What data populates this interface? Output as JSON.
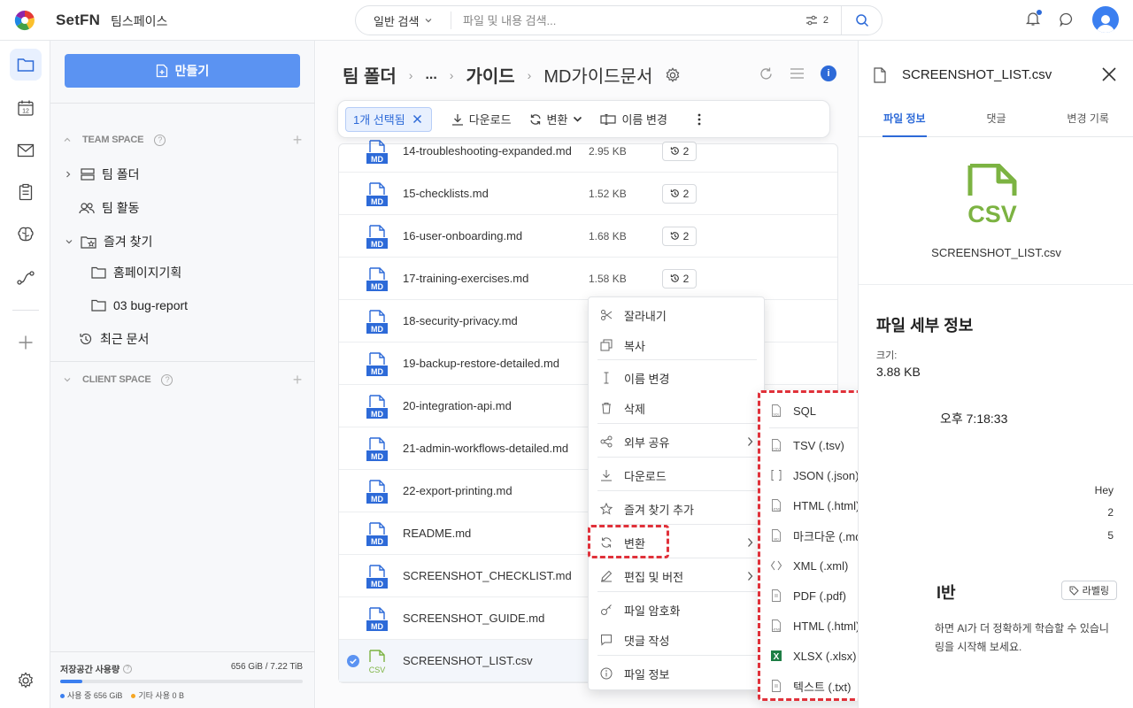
{
  "app": {
    "brand": "SetFN",
    "workspace": "팀스페이스"
  },
  "search": {
    "type_label": "일반 검색",
    "placeholder": "파일 및 내용 검색...",
    "filter_count": "2"
  },
  "sidebar": {
    "create_label": "만들기",
    "team_space_label": "TEAM SPACE",
    "client_space_label": "CLIENT SPACE",
    "items": [
      {
        "label": "팀 폴더"
      },
      {
        "label": "팀 활동"
      },
      {
        "label": "즐겨 찾기"
      },
      {
        "label": "홈페이지기획"
      },
      {
        "label": "03 bug-report"
      },
      {
        "label": "최근 문서"
      }
    ],
    "storage": {
      "title": "저장공간 사용량",
      "size": "656 GiB / 7.22 TiB",
      "used_fraction": 0.09,
      "legend_used": "사용 중 656 GiB",
      "legend_other": "기타 사용 0 B"
    }
  },
  "breadcrumb": {
    "root": "팀 폴더",
    "ellipsis": "...",
    "mid": "가이드",
    "current": "MD가이드문서"
  },
  "toolbar": {
    "selected_label": "1개 선택됨",
    "download_label": "다운로드",
    "convert_label": "변환",
    "rename_label": "이름 변경"
  },
  "files": [
    {
      "name": "14-troubleshooting-expanded.md",
      "size": "2.95 KB",
      "versions": "2",
      "type": "md"
    },
    {
      "name": "15-checklists.md",
      "size": "1.52 KB",
      "versions": "2",
      "type": "md"
    },
    {
      "name": "16-user-onboarding.md",
      "size": "1.68 KB",
      "versions": "2",
      "type": "md"
    },
    {
      "name": "17-training-exercises.md",
      "size": "1.58 KB",
      "versions": "2",
      "type": "md"
    },
    {
      "name": "18-security-privacy.md",
      "size": "",
      "versions": "",
      "type": "md"
    },
    {
      "name": "19-backup-restore-detailed.md",
      "size": "",
      "versions": "",
      "type": "md"
    },
    {
      "name": "20-integration-api.md",
      "size": "",
      "versions": "",
      "type": "md"
    },
    {
      "name": "21-admin-workflows-detailed.md",
      "size": "",
      "versions": "",
      "type": "md"
    },
    {
      "name": "22-export-printing.md",
      "size": "",
      "versions": "",
      "type": "md"
    },
    {
      "name": "README.md",
      "size": "",
      "versions": "",
      "type": "md"
    },
    {
      "name": "SCREENSHOT_CHECKLIST.md",
      "size": "",
      "versions": "",
      "type": "md"
    },
    {
      "name": "SCREENSHOT_GUIDE.md",
      "size": "",
      "versions": "",
      "type": "md"
    },
    {
      "name": "SCREENSHOT_LIST.csv",
      "size": "",
      "versions": "",
      "type": "csv"
    }
  ],
  "context_menu": [
    {
      "label": "잘라내기",
      "icon": "scissors-icon"
    },
    {
      "label": "복사",
      "icon": "copy-icon"
    },
    {
      "label": "이름 변경",
      "icon": "text-cursor-icon"
    },
    {
      "label": "삭제",
      "icon": "trash-icon"
    },
    {
      "label": "외부 공유",
      "icon": "share-icon"
    },
    {
      "label": "다운로드",
      "icon": "download-icon"
    },
    {
      "label": "즐겨 찾기 추가",
      "icon": "star-icon"
    },
    {
      "label": "변환",
      "icon": "convert-icon"
    },
    {
      "label": "편집 및 버전",
      "icon": "pencil-icon"
    },
    {
      "label": "파일 암호화",
      "icon": "key-icon"
    },
    {
      "label": "댓글 작성",
      "icon": "comment-icon"
    },
    {
      "label": "파일 정보",
      "icon": "info-icon"
    }
  ],
  "convert_submenu": [
    {
      "label": "SQL",
      "icon_text": "SQL"
    },
    {
      "label": "TSV (.tsv)",
      "icon_text": "CSV"
    },
    {
      "label": "JSON (.json)",
      "icon_text": "[ ]"
    },
    {
      "label": "HTML (.html)",
      "icon_text": "HTML"
    },
    {
      "label": "마크다운 (.md)",
      "icon_text": "MD"
    },
    {
      "label": "XML (.xml)",
      "icon_text": "< >"
    },
    {
      "label": "PDF (.pdf)",
      "icon_text": ""
    },
    {
      "label": "HTML (.html)",
      "icon_text": "HTML"
    },
    {
      "label": "XLSX (.xlsx)",
      "icon_text": "X"
    },
    {
      "label": "텍스트 (.txt)",
      "icon_text": ""
    }
  ],
  "right_panel": {
    "title": "SCREENSHOT_LIST.csv",
    "tabs": [
      "파일 정보",
      "댓글",
      "변경 기록"
    ],
    "file_name": "SCREENSHOT_LIST.csv",
    "icon_text": "CSV",
    "details_heading": "파일 세부 정보",
    "size_label": "크기:",
    "size_value": "3.88 KB",
    "time_partial": "오후 7:18:33",
    "heading_partial": "ᅡ",
    "row_hey": "Hey",
    "row_2": "2",
    "row_5": "5",
    "ai_heading_partial": "l반",
    "label_button": "라벨링",
    "ai_text_1": "하면 AI가 더 정확하게 학습할 수 있습니",
    "ai_text_2": "링을 시작해 보세요."
  },
  "colors": {
    "accent": "#2d6ad8",
    "create_button": "#5b93f2",
    "highlight_dash": "#e0313a",
    "csv_green": "#7cb342"
  }
}
